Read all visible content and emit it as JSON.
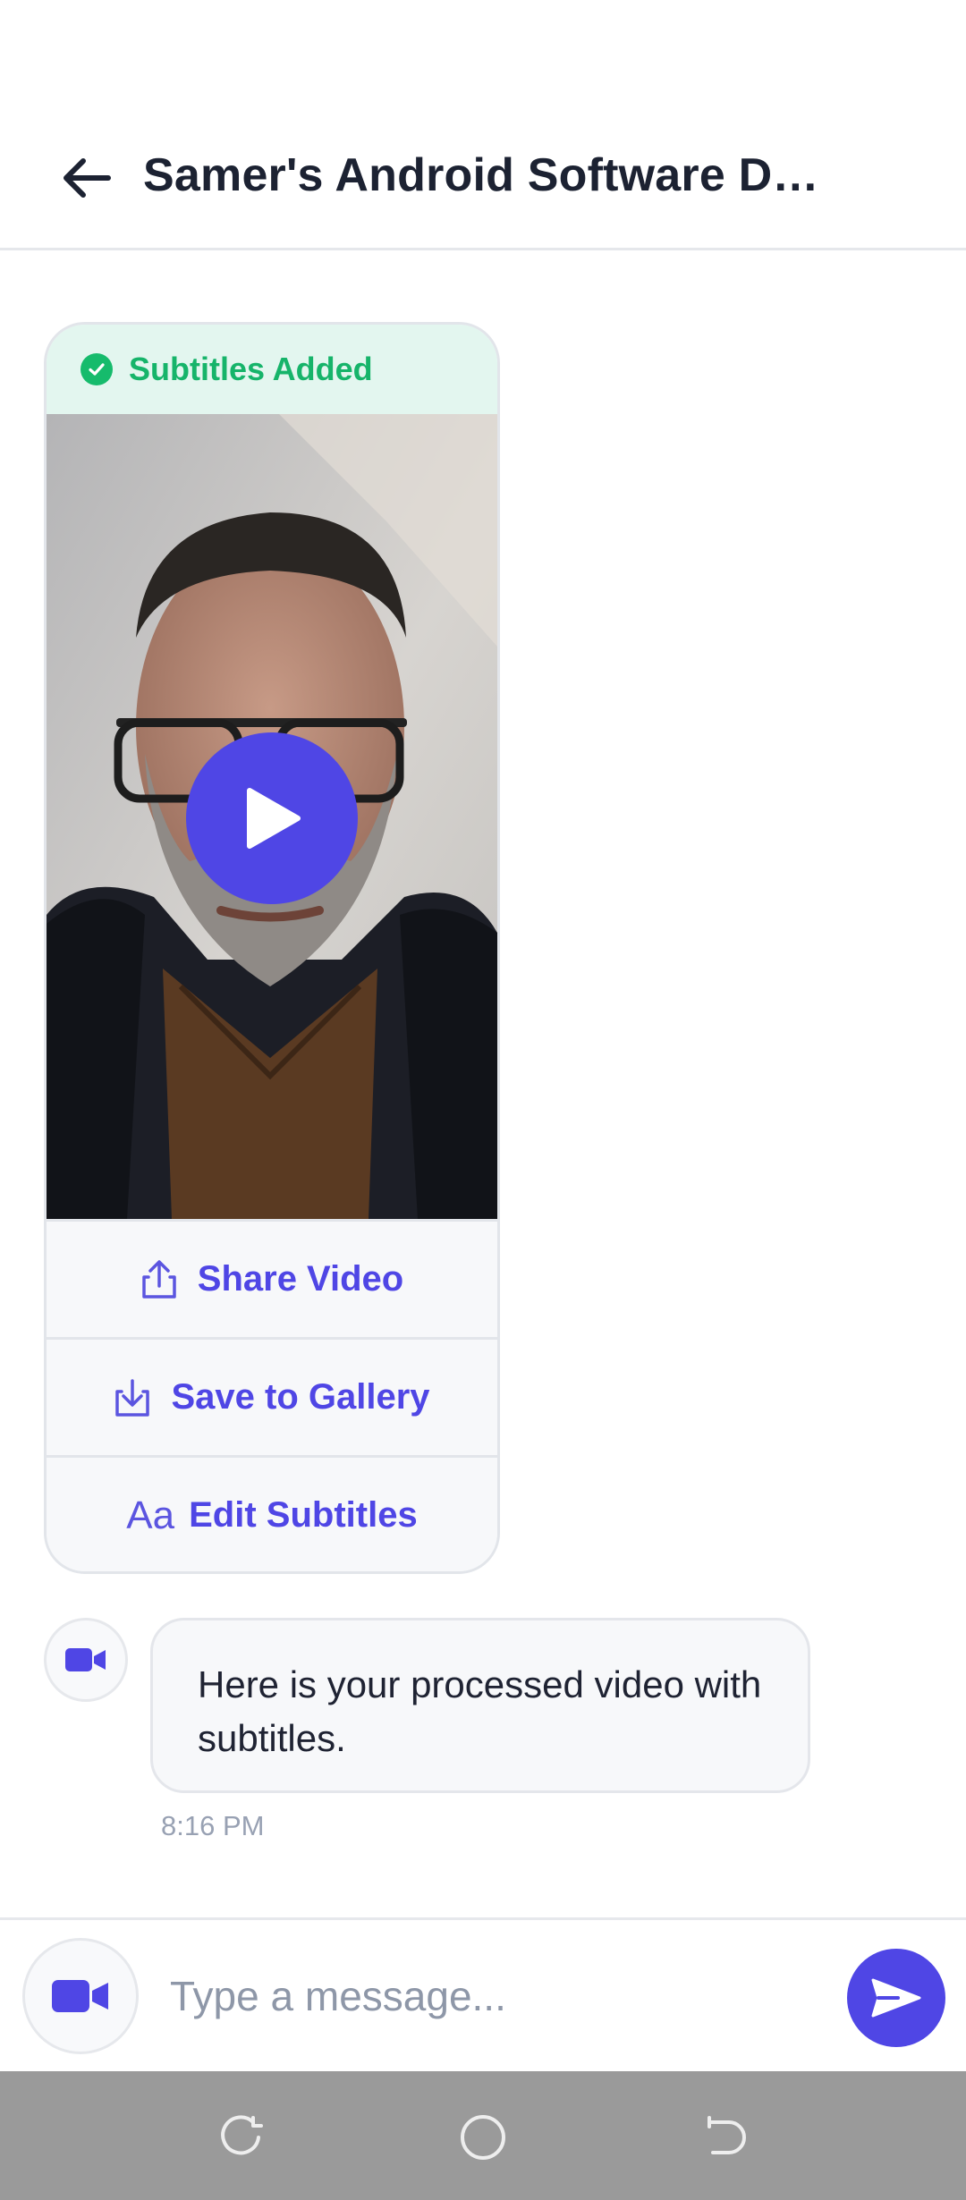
{
  "header": {
    "title": "Samer's Android Software Dev...",
    "back_icon": "arrow-left-icon"
  },
  "video_card": {
    "status": "Subtitles Added",
    "status_icon": "check-circle-icon",
    "status_color": "#16b46a",
    "play_icon": "play-icon",
    "actions": [
      {
        "label": "Share Video",
        "icon": "share-icon"
      },
      {
        "label": "Save to Gallery",
        "icon": "download-icon"
      },
      {
        "label": "Edit Subtitles",
        "icon": "text-format-icon",
        "icon_text": "Aa"
      }
    ]
  },
  "message": {
    "text": "Here is your processed video with subtitles.",
    "time": "8:16 PM",
    "avatar_icon": "video-camera-icon"
  },
  "composer": {
    "placeholder": "Type a message...",
    "camera_icon": "video-camera-icon",
    "send_icon": "send-icon"
  },
  "nav_bar": {
    "buttons": [
      "recents-icon",
      "home-icon",
      "back-icon"
    ]
  },
  "colors": {
    "accent": "#4f46e5",
    "success": "#16b46a",
    "success_bg": "#e3f6ef"
  }
}
